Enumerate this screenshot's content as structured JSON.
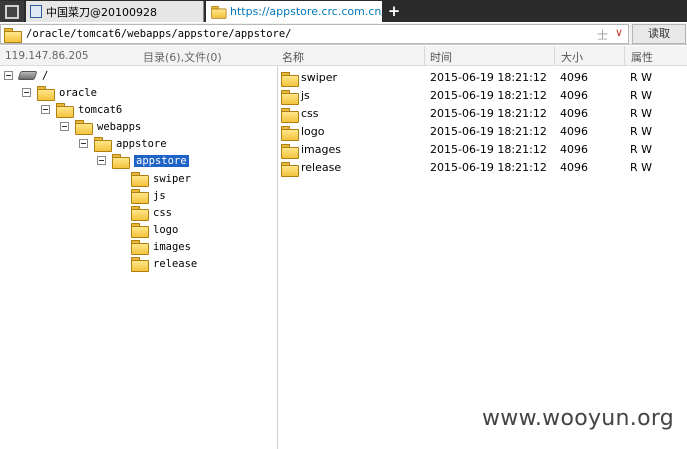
{
  "tabs": [
    {
      "label": "中国菜刀@20100928"
    },
    {
      "label": "https://appstore.crc.com.cn/..."
    }
  ],
  "new_tab_label": "+",
  "address": {
    "path": "/oracle/tomcat6/webapps/appstore/appstore/",
    "pin_glyph": "士",
    "dropdown_glyph": "∨",
    "read_button": "读取"
  },
  "status": {
    "ip": "119.147.86.205",
    "count": "目录(6),文件(0)"
  },
  "columns": {
    "name": "名称",
    "time": "时间",
    "size": "大小",
    "attr": "属性"
  },
  "tree": {
    "root": "/",
    "nodes": [
      {
        "label": "oracle"
      },
      {
        "label": "tomcat6"
      },
      {
        "label": "webapps"
      },
      {
        "label": "appstore"
      },
      {
        "label": "appstore",
        "selected": true
      },
      {
        "label": "swiper"
      },
      {
        "label": "js"
      },
      {
        "label": "css"
      },
      {
        "label": "logo"
      },
      {
        "label": "images"
      },
      {
        "label": "release"
      }
    ]
  },
  "files": [
    {
      "name": "swiper",
      "time": "2015-06-19 18:21:12",
      "size": "4096",
      "attr": "R W"
    },
    {
      "name": "js",
      "time": "2015-06-19 18:21:12",
      "size": "4096",
      "attr": "R W"
    },
    {
      "name": "css",
      "time": "2015-06-19 18:21:12",
      "size": "4096",
      "attr": "R W"
    },
    {
      "name": "logo",
      "time": "2015-06-19 18:21:12",
      "size": "4096",
      "attr": "R W"
    },
    {
      "name": "images",
      "time": "2015-06-19 18:21:12",
      "size": "4096",
      "attr": "R W"
    },
    {
      "name": "release",
      "time": "2015-06-19 18:21:12",
      "size": "4096",
      "attr": "R W"
    }
  ],
  "watermark": "www.wooyun.org",
  "colors": {
    "selection": "#1f63c6",
    "folder": "#f3c33d",
    "tab_text": "#0078b7"
  }
}
